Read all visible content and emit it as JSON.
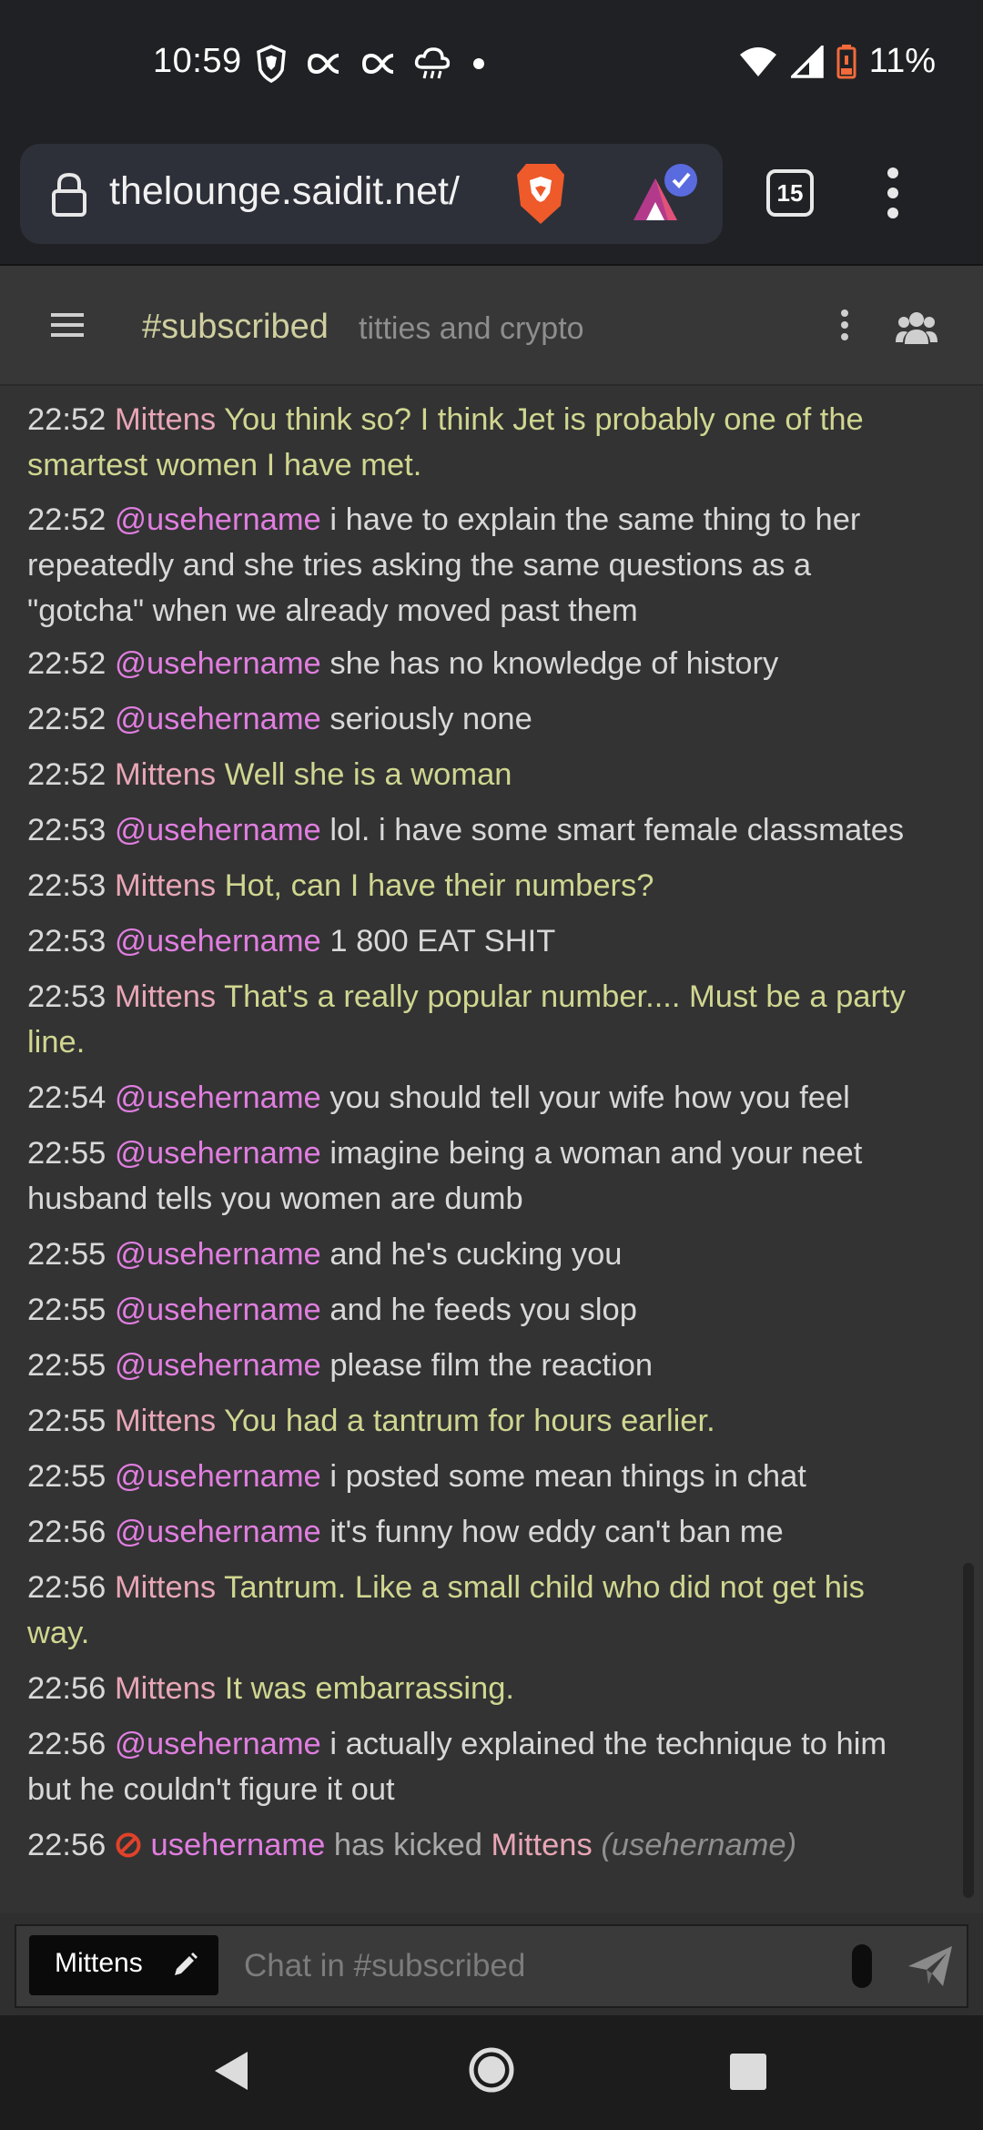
{
  "status_bar": {
    "time": "10:59",
    "battery": "11%",
    "icons": [
      "brave-shield-icon",
      "sync-icon",
      "sync-icon",
      "rain-cloud-icon",
      "dot-icon",
      "wifi-icon",
      "signal-icon",
      "battery-icon"
    ]
  },
  "browser": {
    "url": "thelounge.saidit.net/",
    "tab_count": "15"
  },
  "channel": {
    "name": "#subscribed",
    "topic": "titties and crypto"
  },
  "messages": [
    {
      "time": "22:52",
      "nick": "Mittens",
      "text": "You think so?   I think Jet is probably one of the smartest women I have met.",
      "self": true
    },
    {
      "time": "22:52",
      "nick": "@usehername",
      "text": "i have to explain the same thing to her repeatedly and she tries asking the same questions as a \"gotcha\" when we already moved past them",
      "self": false
    },
    {
      "time": "22:52",
      "nick": "@usehername",
      "text": "she has no knowledge of history",
      "self": false
    },
    {
      "time": "22:52",
      "nick": "@usehername",
      "text": "seriously none",
      "self": false
    },
    {
      "time": "22:52",
      "nick": "Mittens",
      "text": "Well she is a woman",
      "self": true
    },
    {
      "time": "22:53",
      "nick": "@usehername",
      "text": "lol. i have some smart female classmates",
      "self": false
    },
    {
      "time": "22:53",
      "nick": "Mittens",
      "text": "Hot, can I have their numbers?",
      "self": true
    },
    {
      "time": "22:53",
      "nick": "@usehername",
      "text": "1 800 EAT SHIT",
      "self": false
    },
    {
      "time": "22:53",
      "nick": "Mittens",
      "text": "That's a really popular number....  Must be a party line.",
      "self": true
    },
    {
      "time": "22:54",
      "nick": "@usehername",
      "text": "you should tell your wife how you feel",
      "self": false
    },
    {
      "time": "22:55",
      "nick": "@usehername",
      "text": "imagine being a woman and your neet husband tells you women are dumb",
      "self": false
    },
    {
      "time": "22:55",
      "nick": "@usehername",
      "text": "and he's cucking you",
      "self": false
    },
    {
      "time": "22:55",
      "nick": "@usehername",
      "text": "and he feeds you slop",
      "self": false
    },
    {
      "time": "22:55",
      "nick": "@usehername",
      "text": "please film the reaction",
      "self": false
    },
    {
      "time": "22:55",
      "nick": "Mittens",
      "text": "You had a tantrum for hours earlier.",
      "self": true
    },
    {
      "time": "22:55",
      "nick": "@usehername",
      "text": "i posted some mean things in chat",
      "self": false
    },
    {
      "time": "22:56",
      "nick": "@usehername",
      "text": "it's funny how eddy can't ban me",
      "self": false
    },
    {
      "time": "22:56",
      "nick": "Mittens",
      "text": "Tantrum.   Like a small child who did not get his way.",
      "self": true
    },
    {
      "time": "22:56",
      "nick": "Mittens",
      "text": "It was embarrassing.",
      "self": true
    },
    {
      "time": "22:56",
      "nick": "@usehername",
      "text": "i actually explained the technique to him but he couldn't figure it out",
      "self": false
    }
  ],
  "kick_event": {
    "time": "22:56",
    "actor": "usehername",
    "action": "has kicked",
    "target": "Mittens",
    "reason": "(usehername)"
  },
  "input": {
    "nick": "Mittens",
    "placeholder": "Chat in #subscribed"
  },
  "colors": {
    "own_nick": "#e8a6b6",
    "own_text": "#d0d690",
    "other_nick": "#e07ee0",
    "background": "#333333"
  }
}
